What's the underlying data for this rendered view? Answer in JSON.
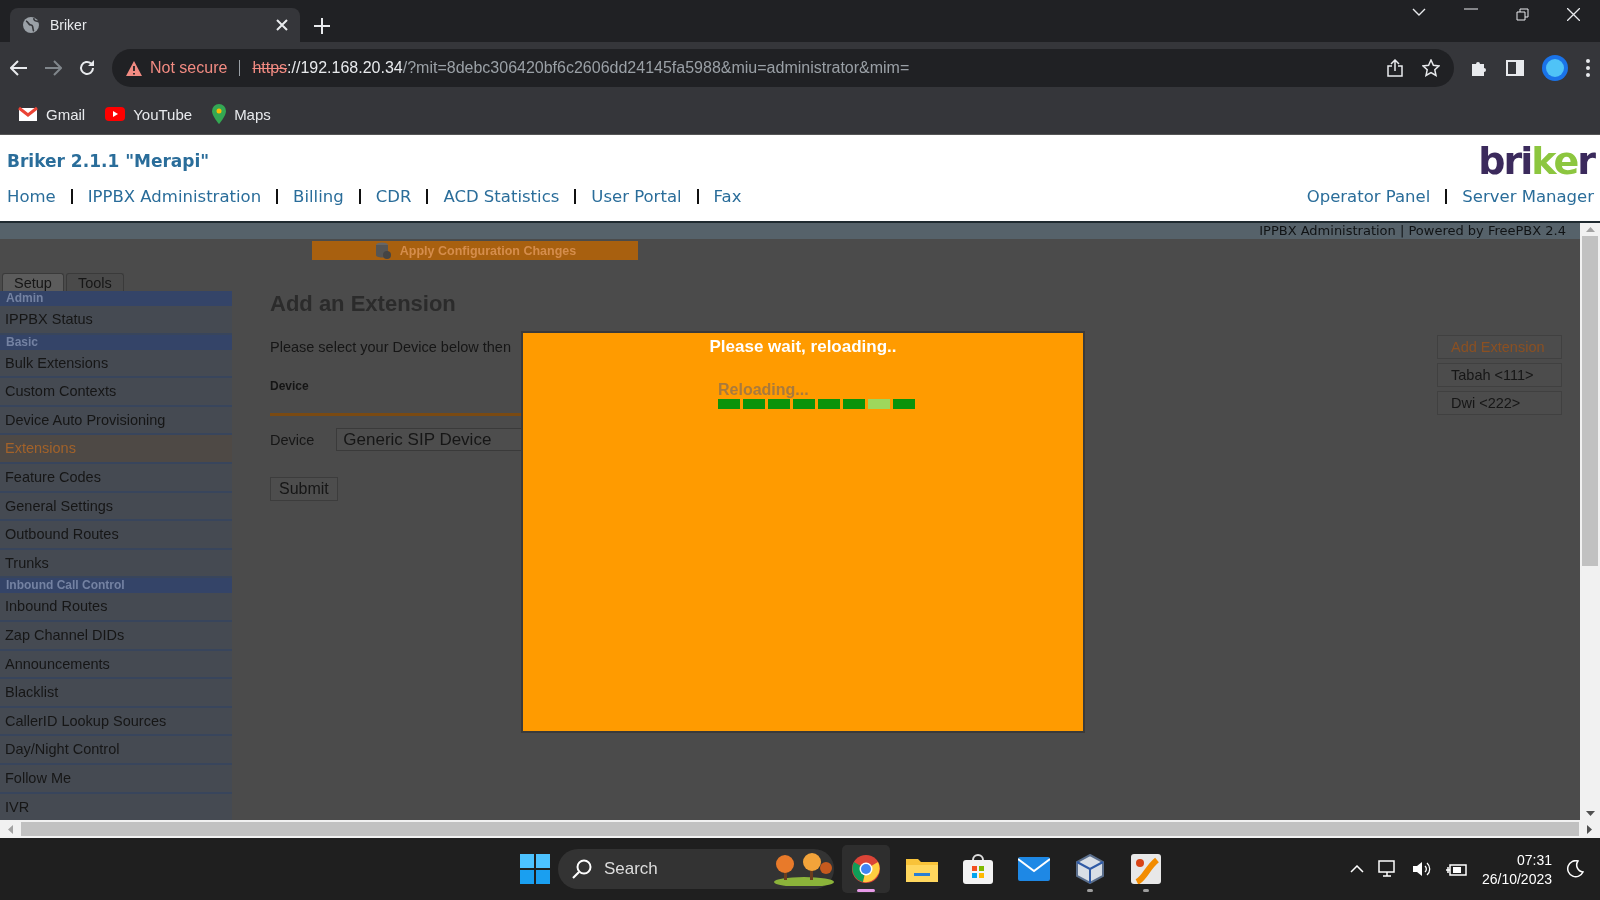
{
  "browser": {
    "tab": {
      "title": "Briker",
      "selected": true
    },
    "address": {
      "warning": "Not secure",
      "scheme": "https",
      "host": "://192.168.20.34",
      "path": "/?mit=8debc306420bf6c2606dd24145fa5988&miu=administrator&mim="
    },
    "bookmarks": [
      {
        "kind": "gmail",
        "label": "Gmail"
      },
      {
        "kind": "youtube",
        "label": "YouTube"
      },
      {
        "kind": "maps",
        "label": "Maps"
      }
    ]
  },
  "header": {
    "title": "Briker 2.1.1 \"Merapi\"",
    "logo": "briker",
    "nav_left": [
      "Home",
      "IPPBX Administration",
      "Billing",
      "CDR",
      "ACD Statistics",
      "User Portal",
      "Fax"
    ],
    "nav_right": [
      "Operator Panel",
      "Server Manager"
    ]
  },
  "subheader": "IPPBX Administration | Powered by FreePBX 2.4",
  "apply_button": "Apply Configuration Changes",
  "tabs": [
    {
      "label": "Setup",
      "selected": true
    },
    {
      "label": "Tools",
      "selected": false
    }
  ],
  "sidebar": [
    {
      "title": "Admin",
      "items": [
        {
          "label": "IPPBX Status",
          "selected": false
        }
      ]
    },
    {
      "title": "Basic",
      "items": [
        {
          "label": "Bulk Extensions",
          "selected": false
        },
        {
          "label": "Custom Contexts",
          "selected": false
        },
        {
          "label": "Device Auto Provisioning",
          "selected": false
        },
        {
          "label": "Extensions",
          "selected": true
        },
        {
          "label": "Feature Codes",
          "selected": false
        },
        {
          "label": "General Settings",
          "selected": false
        },
        {
          "label": "Outbound Routes",
          "selected": false
        },
        {
          "label": "Trunks",
          "selected": false
        }
      ]
    },
    {
      "title": "Inbound Call Control",
      "items": [
        {
          "label": "Inbound Routes",
          "selected": false
        },
        {
          "label": "Zap Channel DIDs",
          "selected": false
        },
        {
          "label": "Announcements",
          "selected": false
        },
        {
          "label": "Blacklist",
          "selected": false
        },
        {
          "label": "CallerID Lookup Sources",
          "selected": false
        },
        {
          "label": "Day/Night Control",
          "selected": false
        },
        {
          "label": "Follow Me",
          "selected": false
        },
        {
          "label": "IVR",
          "selected": false
        }
      ]
    }
  ],
  "content": {
    "heading": "Add an Extension",
    "instructions": "Please select your Device below then",
    "section_label": "Device",
    "field_label": "Device",
    "device_value": "Generic SIP Device",
    "submit": "Submit"
  },
  "extension_list": [
    {
      "label": "Add Extension",
      "selected": true
    },
    {
      "label": "Tabah <111>",
      "selected": false
    },
    {
      "label": "Dwi <222>",
      "selected": false
    }
  ],
  "modal": {
    "title": "Please wait, reloading..",
    "status": "Reloading...",
    "progress_blocks": [
      {
        "highlighted": false
      },
      {
        "highlighted": false
      },
      {
        "highlighted": false
      },
      {
        "highlighted": false
      },
      {
        "highlighted": false
      },
      {
        "highlighted": false
      },
      {
        "highlighted": true
      },
      {
        "highlighted": false
      }
    ]
  },
  "taskbar": {
    "search_placeholder": "Search",
    "apps": [
      {
        "kind": "chrome",
        "open": true,
        "selected": true
      },
      {
        "kind": "files",
        "open": false,
        "selected": false
      },
      {
        "kind": "store",
        "open": false,
        "selected": false
      },
      {
        "kind": "mail",
        "open": false,
        "selected": false
      },
      {
        "kind": "cube",
        "open": true,
        "selected": false
      },
      {
        "kind": "tool",
        "open": true,
        "selected": false
      }
    ],
    "time": "07:31",
    "date": "26/10/2023"
  }
}
